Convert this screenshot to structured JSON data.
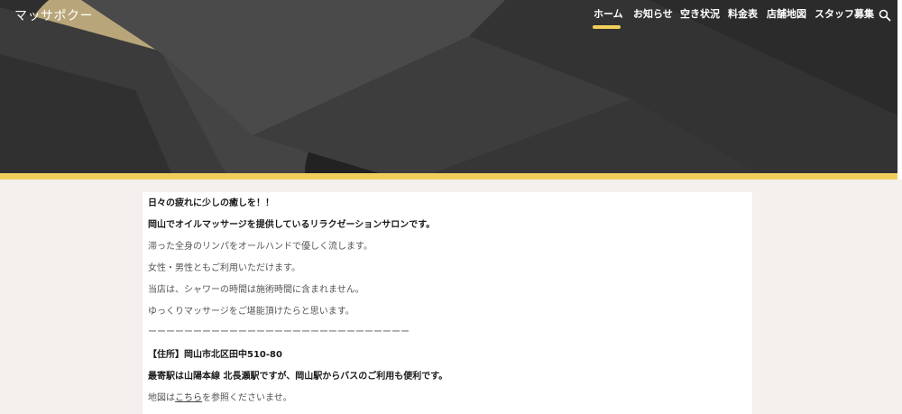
{
  "header": {
    "site_title": "マッサポクー",
    "nav": [
      {
        "label": "ホーム"
      },
      {
        "label": "お知らせ"
      },
      {
        "label": "空き状況"
      },
      {
        "label": "料金表"
      },
      {
        "label": "店舗地図"
      },
      {
        "label": "スタッフ募集"
      }
    ],
    "active_nav": "ホーム",
    "icons": {
      "search": "search-icon"
    }
  },
  "colors": {
    "accent": "#f2cf5a",
    "hero_background": "#2f2f2f",
    "page_background": "#f3f0ee"
  },
  "content": {
    "heading": "日々の疲れに少しの癒しを！！",
    "intro": "岡山でオイルマッサージを提供しているリラクゼーションサロンです。",
    "p1": "滞った全身のリンパをオールハンドで優しく流します。",
    "p2": "女性・男性ともご利用いただけます。",
    "p3": "当店は、シャワーの時間は施術時間に含まれません。",
    "p4": "ゆっくりマッサージをご堪能頂けたらと思います。",
    "divider": "ーーーーーーーーーーーーーーーーーーーーーーーーーーーーー",
    "address": "【住所】岡山市北区田中510-80",
    "station": "最寄駅は山陽本線 北長瀬駅ですが、岡山駅からバスのご利用も便利です。",
    "map_prefix": "地図は",
    "map_link": "こちら",
    "map_suffix": "を参照くださいませ。"
  }
}
